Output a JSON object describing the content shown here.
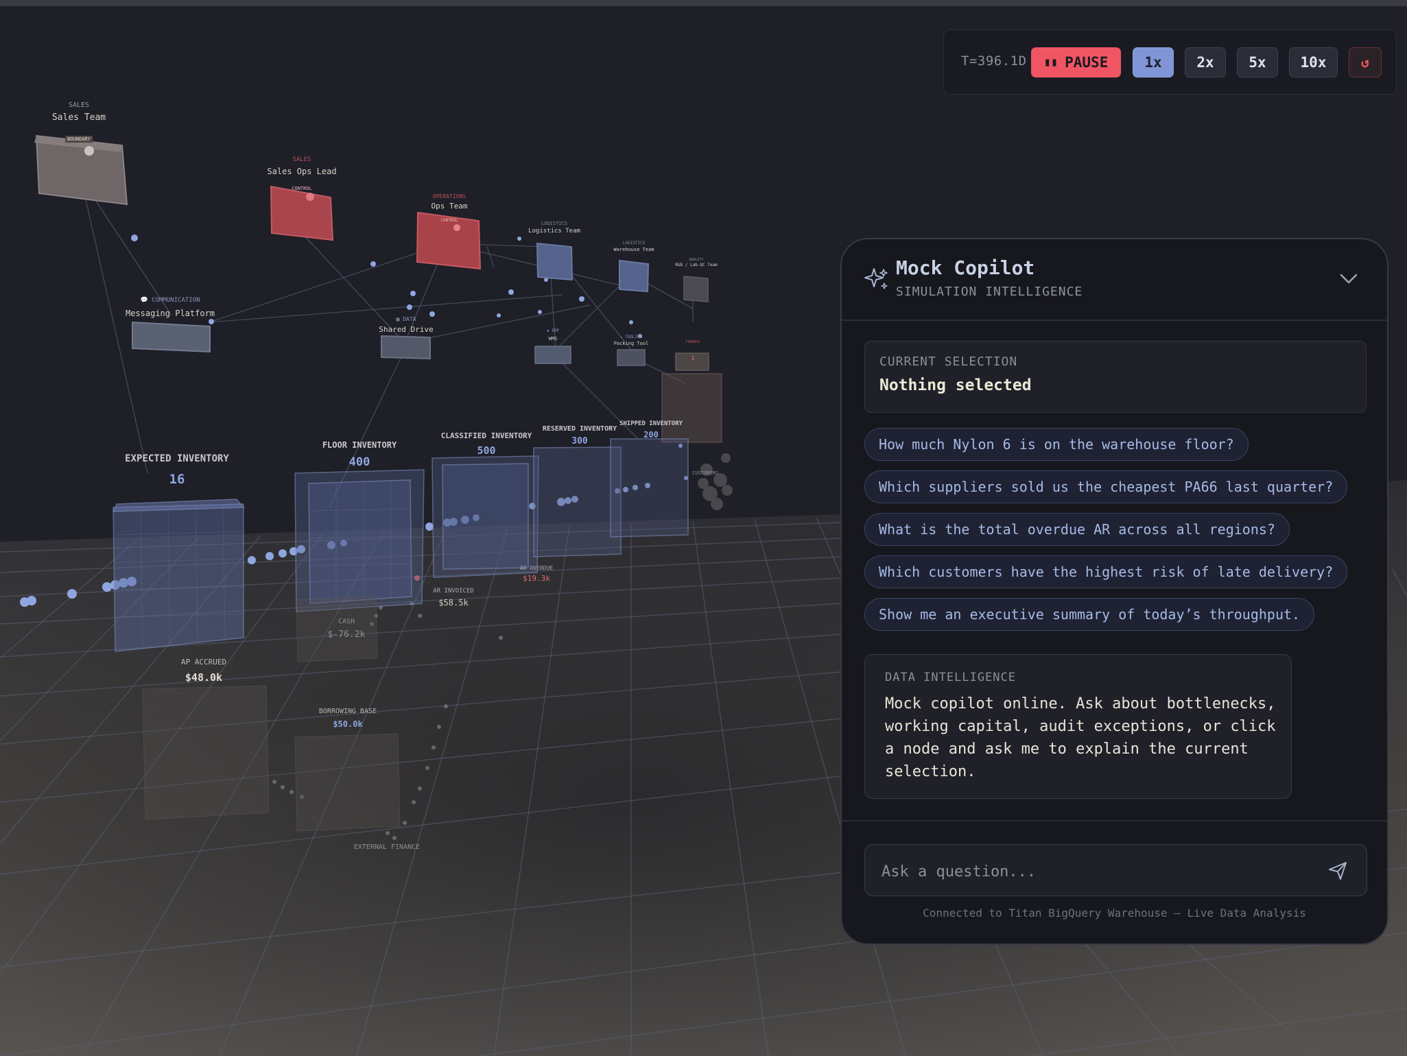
{
  "sim": {
    "clock": "T=396.1D",
    "pause_icon": "pause-icon",
    "pause_label": "PAUSE",
    "speeds": [
      "1x",
      "2x",
      "5x",
      "10x"
    ],
    "active_speed": "1x",
    "reset_icon": "reset-icon",
    "reset_glyph": "↺"
  },
  "scene": {
    "teams": {
      "sales_team": {
        "category": "SALES",
        "name": "Sales Team",
        "tag": "BOUNDARY"
      },
      "sales_ops": {
        "category": "SALES",
        "name": "Sales Ops Lead",
        "tag": "CONTROL"
      },
      "ops_team": {
        "category": "OPERATIONS",
        "name": "Ops Team",
        "tag": "CONTROL"
      },
      "logistics_team": {
        "category": "LOGISTICS",
        "name": "Logistics Team"
      },
      "warehouse_team": {
        "category": "LOGISTICS",
        "name": "Warehouse Team"
      },
      "qc_team": {
        "category": "QUALITY",
        "name": "R&D / Lab-QC Team"
      },
      "messaging": {
        "category": "COMMUNICATION",
        "name": "Messaging Platform"
      },
      "shared_drive": {
        "category": "DATA",
        "name": "Shared Drive"
      },
      "wms": {
        "category": "ERP",
        "name": "WMS"
      },
      "packing_tool": {
        "category": "TOOLING",
        "name": "Packing Tool"
      },
      "finance": {
        "category": "FINANCE",
        "count": "1"
      },
      "customers": {
        "name": "CUSTOMERS"
      },
      "external_finance": {
        "name": "EXTERNAL FINANCE"
      }
    },
    "inventory": [
      {
        "name": "EXPECTED INVENTORY",
        "value": "16"
      },
      {
        "name": "FLOOR INVENTORY",
        "value": "400"
      },
      {
        "name": "CLASSIFIED INVENTORY",
        "value": "500"
      },
      {
        "name": "RESERVED INVENTORY",
        "value": "300"
      },
      {
        "name": "SHIPPED INVENTORY",
        "value": "200"
      }
    ],
    "finance": {
      "cash": {
        "name": "CASH",
        "value": "$-76.2k"
      },
      "ar_invoiced": {
        "name": "AR INVOICED",
        "value": "$58.5k"
      },
      "ar_overdue": {
        "name": "AR OVERDUE",
        "value": "$19.3k"
      },
      "ap_accrued": {
        "name": "AP ACCRUED",
        "value": "$48.0k"
      },
      "borrowing_base": {
        "name": "BORROWING BASE",
        "value": "$50.0k"
      }
    }
  },
  "copilot": {
    "icon": "sparkle-icon",
    "title": "Mock Copilot",
    "subtitle": "SIMULATION INTELLIGENCE",
    "collapse_icon": "chevron-down-icon",
    "selection_label": "CURRENT SELECTION",
    "selection_value": "Nothing selected",
    "suggestions": [
      "How much Nylon 6 is on the warehouse floor?",
      "Which suppliers sold us the cheapest PA66 last quarter?",
      "What is the total overdue AR across all regions?",
      "Which customers have the highest risk of late delivery?",
      "Show me an executive summary of today’s throughput."
    ],
    "message_label": "DATA INTELLIGENCE",
    "message_body": "Mock copilot online. Ask about bottlenecks, working capital, audit exceptions, or click a node and ask me to explain the current selection.",
    "input_placeholder": "Ask a question...",
    "send_icon": "send-icon",
    "footer": "Connected to Titan BigQuery Warehouse — Live Data Analysis"
  }
}
